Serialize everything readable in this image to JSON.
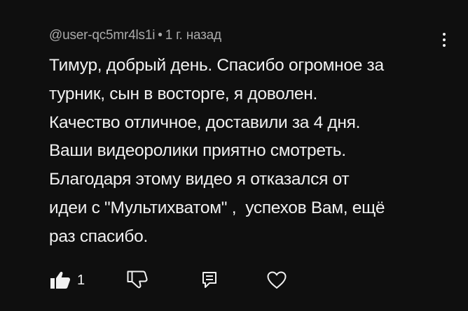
{
  "comment": {
    "author": "@user-qc5mr4ls1i",
    "separator": "•",
    "time": "1 г. назад",
    "lines": [
      "Тимур, добрый день. Спасибо огромное за",
      "турник, сын в восторге, я доволен.",
      "Качество отличное, доставили за 4 дня.",
      "Ваши видеоролики приятно смотреть.",
      "Благодаря этому видео я отказался от",
      "идеи с \"Мультихватом\" ,  успехов Вам, ещё",
      "раз спасибо."
    ]
  },
  "actions": {
    "like_count": "1",
    "like_icon": "thumbs-up-filled-icon",
    "dislike_icon": "thumbs-down-outline-icon",
    "reply_icon": "reply-comment-icon",
    "heart_icon": "heart-outline-icon"
  },
  "colors": {
    "background": "#0f0f0f",
    "text": "#f1f1f1",
    "meta": "#aaaaaa"
  }
}
